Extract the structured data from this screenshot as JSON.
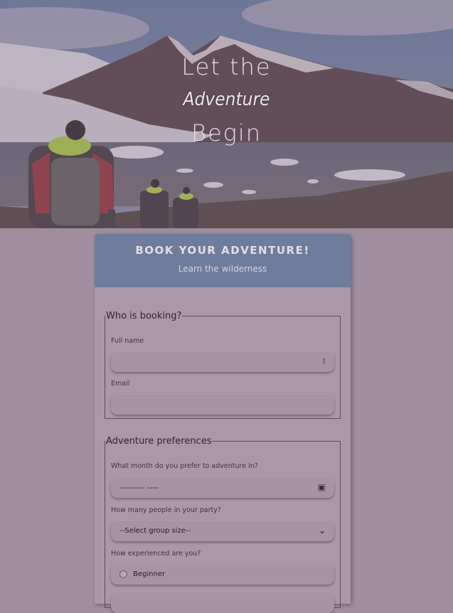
{
  "hero": {
    "line1": "Let the",
    "line2": "Adventure",
    "line3": "Begin"
  },
  "card": {
    "title": "Book your adventure!",
    "subtitle": "Learn the wilderness"
  },
  "booking": {
    "legend": "Who is booking?",
    "name_label": "Full name",
    "email_label": "Email"
  },
  "preferences": {
    "legend": "Adventure preferences",
    "month_label": "What month do you prefer to adventure in?",
    "month_value": "---------  ----",
    "party_label": "How many people in your party?",
    "party_value": "--Select group size--",
    "experience_label": "How experienced are you?",
    "experience_option_1": "Beginner"
  },
  "colors": {
    "overlay": "#a08e9e",
    "header": "#6e7d9c"
  }
}
